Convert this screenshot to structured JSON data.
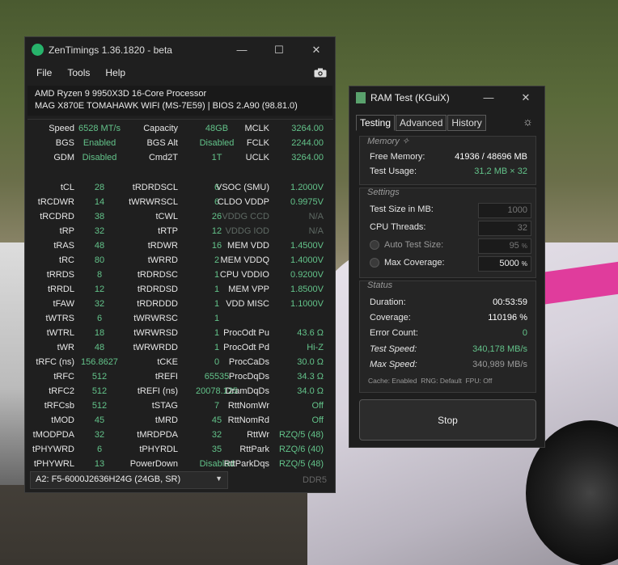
{
  "zt": {
    "title": "ZenTimings 1.36.1820 - beta",
    "menu": [
      "File",
      "Tools",
      "Help"
    ],
    "cpu": "AMD Ryzen 9 9950X3D 16-Core Processor",
    "board": "MAG X870E TOMAHAWK WIFI (MS-7E59) | BIOS 2.A90 (98.81.0)",
    "rows": [
      [
        [
          "Speed",
          "6528 MT/s"
        ],
        [
          "Capacity",
          "48GB"
        ],
        [
          "MCLK",
          "3264.00"
        ]
      ],
      [
        [
          "BGS",
          "Enabled"
        ],
        [
          "BGS Alt",
          "Disabled"
        ],
        [
          "FCLK",
          "2244.00"
        ]
      ],
      [
        [
          "GDM",
          "Disabled"
        ],
        [
          "Cmd2T",
          "1T"
        ],
        [
          "UCLK",
          "3264.00"
        ]
      ],
      [
        [
          "tCL",
          "28"
        ],
        [
          "tRDRDSCL",
          "6"
        ],
        [
          "VSOC (SMU)",
          "1.2000V"
        ]
      ],
      [
        [
          "tRCDWR",
          "14"
        ],
        [
          "tWRWRSCL",
          "6"
        ],
        [
          "CLDO VDDP",
          "0.9975V"
        ]
      ],
      [
        [
          "tRCDRD",
          "38"
        ],
        [
          "tCWL",
          "26"
        ],
        [
          "VDDG CCD",
          "N/A"
        ]
      ],
      [
        [
          "tRP",
          "32"
        ],
        [
          "tRTP",
          "12"
        ],
        [
          "VDDG IOD",
          "N/A"
        ]
      ],
      [
        [
          "tRAS",
          "48"
        ],
        [
          "tRDWR",
          "16"
        ],
        [
          "MEM VDD",
          "1.4500V"
        ]
      ],
      [
        [
          "tRC",
          "80"
        ],
        [
          "tWRRD",
          "2"
        ],
        [
          "MEM VDDQ",
          "1.4000V"
        ]
      ],
      [
        [
          "tRRDS",
          "8"
        ],
        [
          "tRDRDSC",
          "1"
        ],
        [
          "CPU VDDIO",
          "0.9200V"
        ]
      ],
      [
        [
          "tRRDL",
          "12"
        ],
        [
          "tRDRDSD",
          "1"
        ],
        [
          "MEM VPP",
          "1.8500V"
        ]
      ],
      [
        [
          "tFAW",
          "32"
        ],
        [
          "tRDRDDD",
          "1"
        ],
        [
          "VDD MISC",
          "1.1000V"
        ]
      ],
      [
        [
          "tWTRS",
          "6"
        ],
        [
          "tWRWRSC",
          "1"
        ],
        [
          "",
          ""
        ]
      ],
      [
        [
          "tWTRL",
          "18"
        ],
        [
          "tWRWRSD",
          "1"
        ],
        [
          "ProcOdt Pu",
          "43.6 Ω"
        ]
      ],
      [
        [
          "tWR",
          "48"
        ],
        [
          "tWRWRDD",
          "1"
        ],
        [
          "ProcOdt Pd",
          "Hi-Z"
        ]
      ],
      [
        [
          "tRFC (ns)",
          "156.8627"
        ],
        [
          "tCKE",
          "0"
        ],
        [
          "ProcCaDs",
          "30.0 Ω"
        ]
      ],
      [
        [
          "tRFC",
          "512"
        ],
        [
          "tREFI",
          "65535"
        ],
        [
          "ProcDqDs",
          "34.3 Ω"
        ]
      ],
      [
        [
          "tRFC2",
          "512"
        ],
        [
          "tREFI (ns)",
          "20078.125"
        ],
        [
          "DramDqDs",
          "34.0 Ω"
        ]
      ],
      [
        [
          "tRFCsb",
          "512"
        ],
        [
          "tSTAG",
          "7"
        ],
        [
          "RttNomWr",
          "Off"
        ]
      ],
      [
        [
          "tMOD",
          "45"
        ],
        [
          "tMRD",
          "45"
        ],
        [
          "RttNomRd",
          "Off"
        ]
      ],
      [
        [
          "tMODPDA",
          "32"
        ],
        [
          "tMRDPDA",
          "32"
        ],
        [
          "RttWr",
          "RZQ/5 (48)"
        ]
      ],
      [
        [
          "tPHYWRD",
          "6"
        ],
        [
          "tPHYRDL",
          "35"
        ],
        [
          "RttPark",
          "RZQ/6 (40)"
        ]
      ],
      [
        [
          "tPHYWRL",
          "13"
        ],
        [
          "PowerDown",
          "Disabled"
        ],
        [
          "RttParkDqs",
          "RZQ/5 (48)"
        ]
      ]
    ],
    "dim_values": [
      "N/A"
    ],
    "module": "A2: F5-6000J2636H24G (24GB, SR)",
    "ddr": "DDR5",
    "window_buttons": [
      "—",
      "☐",
      "✕"
    ]
  },
  "rt": {
    "title": "RAM Test (KGuiX)",
    "tabs": [
      "Testing",
      "Advanced",
      "History"
    ],
    "memory": {
      "title": "Memory ✧",
      "free_label": "Free Memory:",
      "free_value": "41936 / 48696 MB",
      "usage_label": "Test Usage:",
      "usage_value": "31,2 MB × 32"
    },
    "settings": {
      "title": "Settings",
      "size_label": "Test Size in MB:",
      "size_value": "1000",
      "threads_label": "CPU Threads:",
      "threads_value": "32",
      "auto_label": "Auto Test Size:",
      "auto_value": "95",
      "cov_label": "Max Coverage:",
      "cov_value": "5000",
      "pct": "%"
    },
    "status": {
      "title": "Status",
      "dur_label": "Duration:",
      "dur_value": "00:53:59",
      "cov_label": "Coverage:",
      "cov_value": "110196 %",
      "err_label": "Error Count:",
      "err_value": "0",
      "speed_label": "Test Speed:",
      "speed_value": "340,178 MB/s",
      "max_label": "Max Speed:",
      "max_value": "340,989 MB/s",
      "footer": "Cache: Enabled  RNG: Default  FPU: Off"
    },
    "stop": "Stop",
    "window_buttons": [
      "—",
      "✕"
    ]
  },
  "colors": {
    "green_value": "#63c38a",
    "accent": "#27b36b"
  }
}
